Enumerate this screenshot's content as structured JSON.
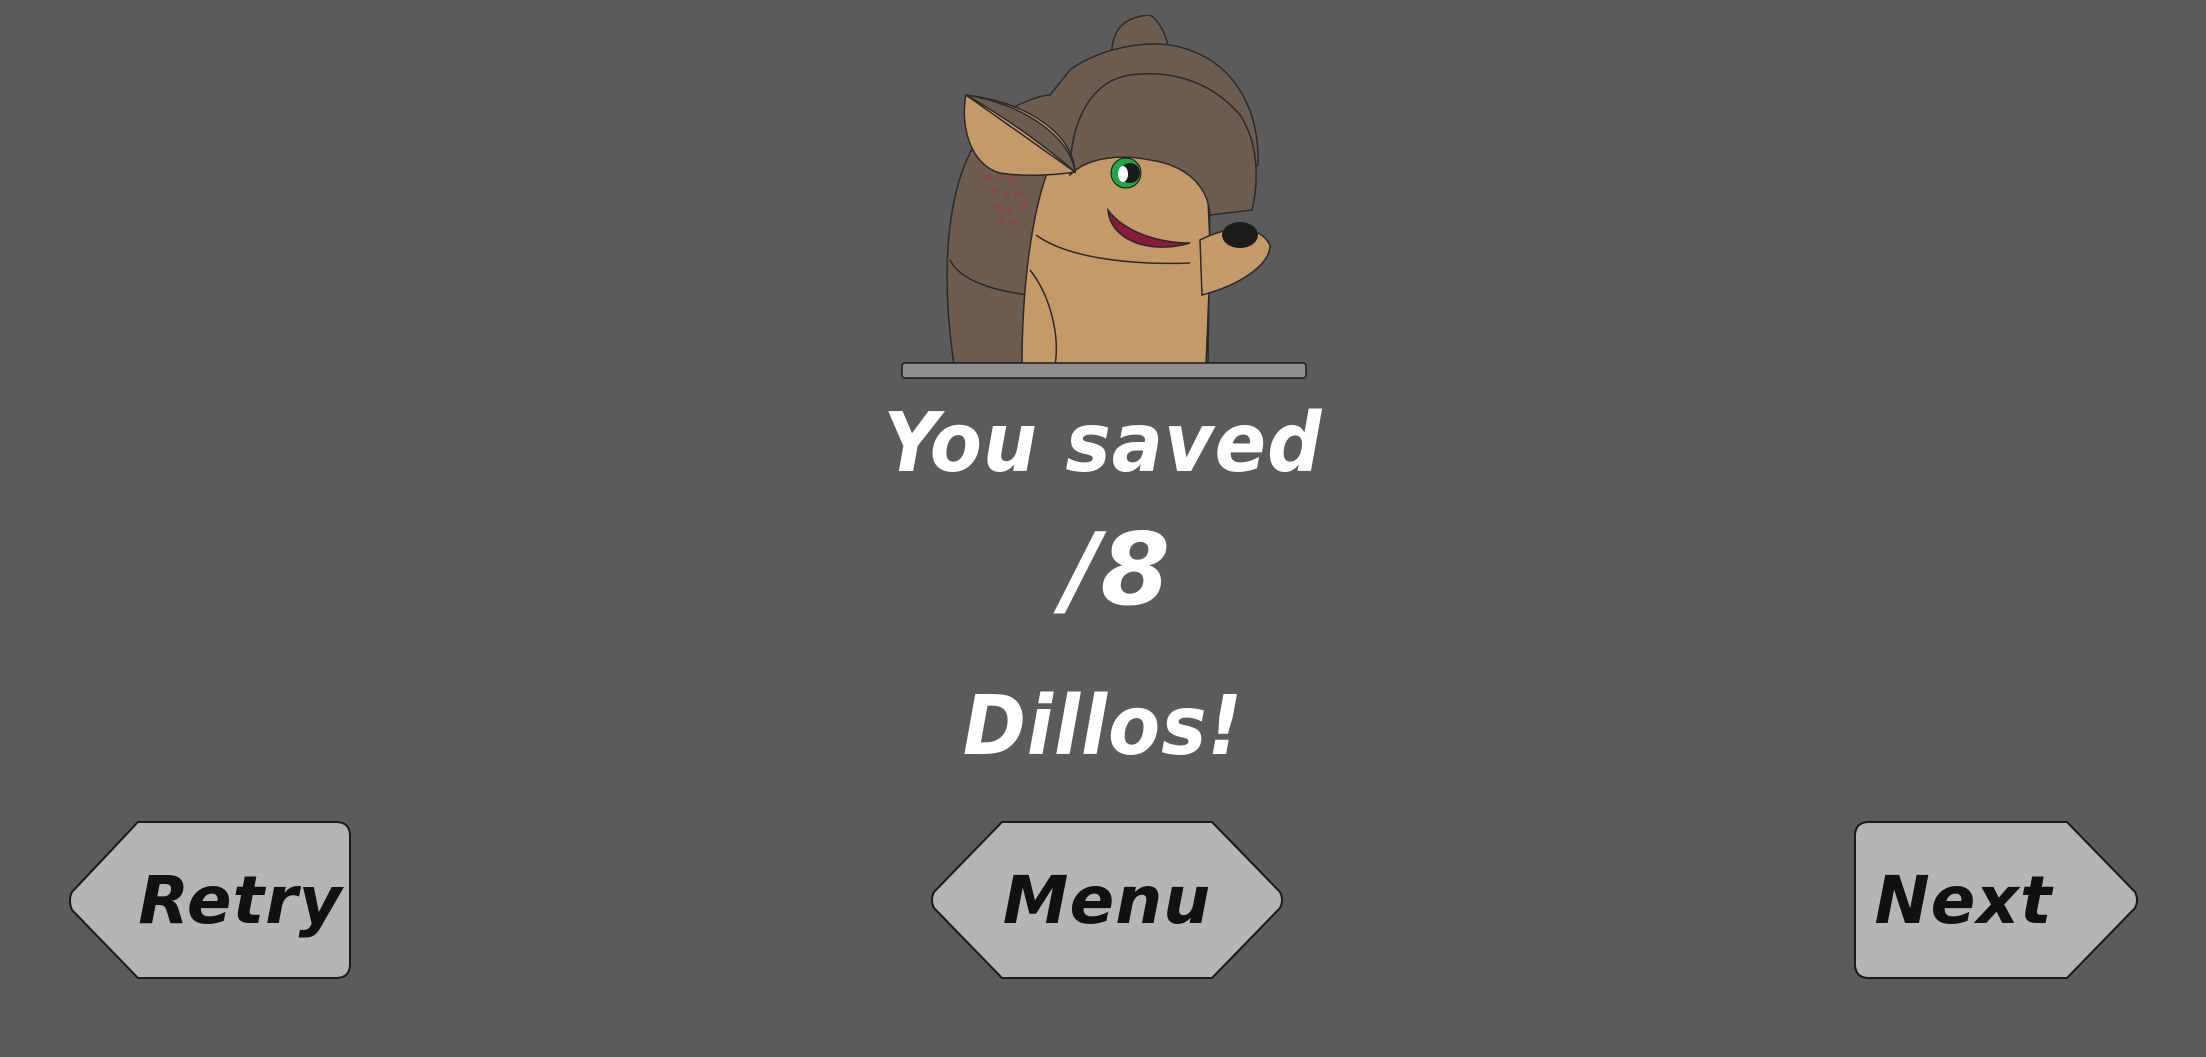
{
  "result": {
    "line1": "You saved",
    "score_display": "/8",
    "line3": "Dillos!"
  },
  "buttons": {
    "retry_label": "Retry",
    "menu_label": "Menu",
    "next_label": "Next"
  },
  "colors": {
    "background": "#5b5b5b",
    "button_fill": "#b5b5b5",
    "button_text": "#111111",
    "message_text": "#ffffff"
  }
}
